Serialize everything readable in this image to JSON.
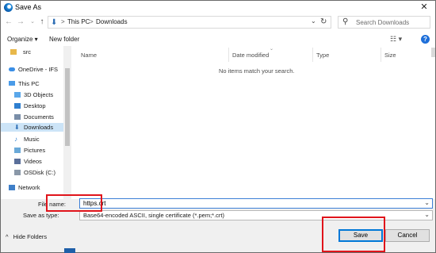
{
  "title": "Save As",
  "address": {
    "crumbs": [
      "This PC",
      "Downloads"
    ],
    "separator": ">",
    "search_placeholder": "Search Downloads"
  },
  "toolbar": {
    "organize": "Organize ▾",
    "new_folder": "New folder"
  },
  "nav": {
    "items": [
      {
        "label": "src",
        "icon": "folder-icon"
      },
      {
        "label": "OneDrive - IFS",
        "icon": "cloud-icon"
      },
      {
        "label": "This PC",
        "icon": "computer-icon"
      },
      {
        "label": "3D Objects",
        "icon": "cube-icon"
      },
      {
        "label": "Desktop",
        "icon": "desktop-icon"
      },
      {
        "label": "Documents",
        "icon": "documents-icon"
      },
      {
        "label": "Downloads",
        "icon": "download-icon",
        "selected": true
      },
      {
        "label": "Music",
        "icon": "music-icon"
      },
      {
        "label": "Pictures",
        "icon": "pictures-icon"
      },
      {
        "label": "Videos",
        "icon": "videos-icon"
      },
      {
        "label": "OSDisk (C:)",
        "icon": "disk-icon"
      },
      {
        "label": "Network",
        "icon": "network-icon"
      }
    ]
  },
  "list": {
    "columns": [
      "Name",
      "Date modified",
      "Type",
      "Size"
    ],
    "empty_message": "No items match your search."
  },
  "form": {
    "file_name_label": "File name:",
    "file_name_value": "https.crt",
    "save_type_label": "Save as type:",
    "save_type_value": "Base64-encoded ASCII, single certificate (*.pem;*.crt)"
  },
  "footer": {
    "hide_folders": "Hide Folders",
    "save": "Save",
    "cancel": "Cancel"
  },
  "colors": {
    "accent": "#0078d7",
    "highlight_box": "#e0141b",
    "selection": "#cce4f7"
  }
}
